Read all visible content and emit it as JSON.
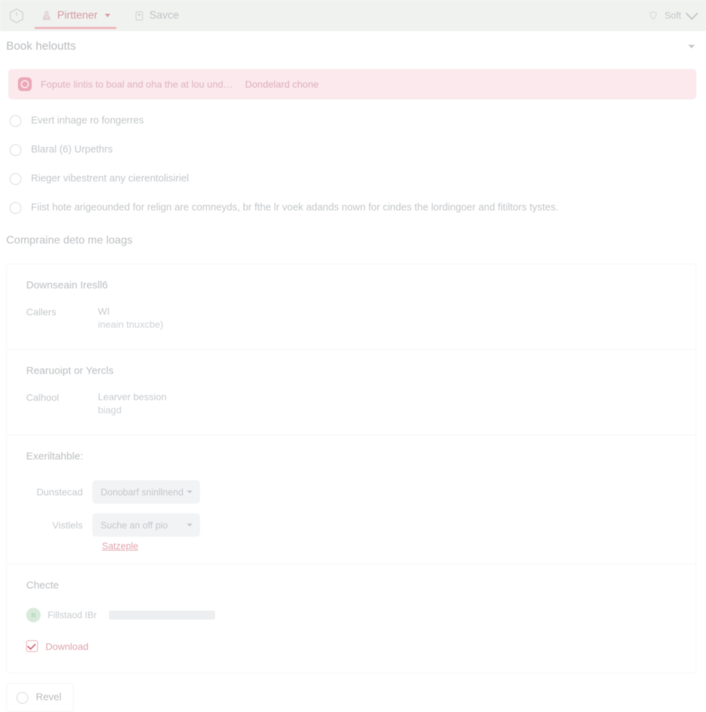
{
  "topbar": {
    "logo_icon": "cube-icon",
    "tabs": [
      {
        "label": "Pirttener",
        "icon": "stamp-person-icon",
        "active": true,
        "has_caret": true
      },
      {
        "label": "Savce",
        "icon": "document-icon",
        "active": false,
        "has_caret": false
      }
    ],
    "status": {
      "label": "Soft",
      "icon": "shield-icon",
      "caret_icon": "chevron-down-icon"
    },
    "accent_color": "#eeb6bb",
    "background_color": "#f0f2f0"
  },
  "page_header": {
    "title": "Book heloutts",
    "collapse_icon": "chevron-down-icon"
  },
  "alert": {
    "icon": "error-badge-icon",
    "message": "Fopute lintis to boal and oha the at lou und…",
    "link_label": "Dondelard chone",
    "background_color": "#fbe9ed",
    "text_color": "#dfb4bd"
  },
  "radio_options": [
    {
      "label": "Evert inhage ro fongerres",
      "selected": false
    },
    {
      "label": "Blaral (6) Urpethrs",
      "selected": false
    },
    {
      "label": "Rieger vibestrent any cierentolisiriel",
      "selected": false
    },
    {
      "label": "Fiist hote arigeounded for relign are comneyds, br fthe lr voek adands nown for cindes the lordingoer and fitiltors tystes.",
      "selected": false
    }
  ],
  "section": {
    "title": "Compraine deto me loags"
  },
  "card": {
    "blocks": [
      {
        "title": "Downseain Iresll6",
        "type": "fields",
        "fields": [
          {
            "label": "Callers",
            "value": "WI",
            "value_sub": "ineain tnuxcbe)"
          }
        ]
      },
      {
        "title": "Rearuoipt or Yercls",
        "type": "fields",
        "fields": [
          {
            "label": "Calhool",
            "value": "Learver bession",
            "value_sub": "biagd"
          }
        ]
      },
      {
        "title": "Exeriltahble:",
        "type": "form",
        "rows": [
          {
            "label": "Dunstecad",
            "select_value": "Donobarf sninllnend",
            "caret_icon": "chevron-down-icon"
          },
          {
            "label": "Vistlels",
            "select_value": "Suche an off pio",
            "caret_icon": "chevron-down-icon"
          }
        ],
        "helper_link": "Satzeple"
      },
      {
        "title": "Checte",
        "type": "meta",
        "avatar": {
          "initial": "n",
          "color": "#d8ebdb"
        },
        "avatar_label": "Fillstaod IBr",
        "redacted_value": "",
        "checkbox": {
          "label": "Download",
          "checked": true,
          "accent_color": "#d4707f"
        }
      }
    ]
  },
  "footer": {
    "button": {
      "label": "Revel",
      "radio_icon": "radio-unchecked-icon",
      "selected": false
    }
  }
}
